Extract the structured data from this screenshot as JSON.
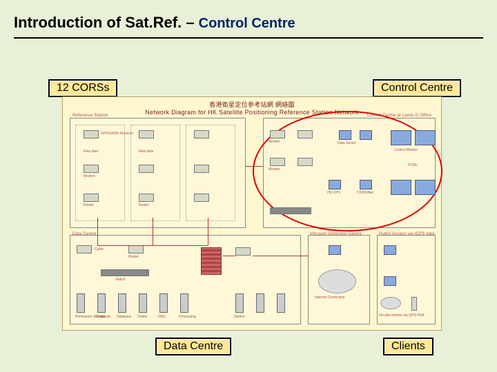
{
  "title_main": "Introduction of Sat.Ref. – ",
  "title_sub": "Control Centre",
  "labels": {
    "cors": "12 CORSs",
    "cc": "Control Centre",
    "dc": "Data Centre",
    "cl": "Clients"
  },
  "diagram": {
    "title_cn": "香港衛星定位參考站網 網絡圖",
    "title_en": "Network Diagram for HK Satellite Positioning Reference Station Network",
    "zone_nw": "Reference Station",
    "zone_ne": "Control Centre at Lands D Office",
    "zone_sw": "Data Centre",
    "zone_se1": "Intrusion Detection Centre",
    "zone_se2": "Public Access via ICPS data",
    "cap_recv": "GPS/GNSS Receiver",
    "cap_raw": "Raw data",
    "cap_router": "Router",
    "cap_modem": "Modem",
    "cap_dataserver": "Data Server",
    "cap_control": "Control Monitor",
    "cap_pcms": "PCMs",
    "cap_hd": "HD CPS",
    "cap_corsnet": "CORS/Net",
    "cap_cable": "Cable",
    "cap_switch": "Switch",
    "cap_perm": "Permanent Storage",
    "cap_dist": "Distribute",
    "cap_db": "Database",
    "cap_online": "Online",
    "cap_dns": "DNS",
    "cap_proc": "Processing",
    "cap_station": "Station",
    "cap_internet": "Internet Connection",
    "cap_onsite": "On-site monitor via GPS PDA"
  }
}
